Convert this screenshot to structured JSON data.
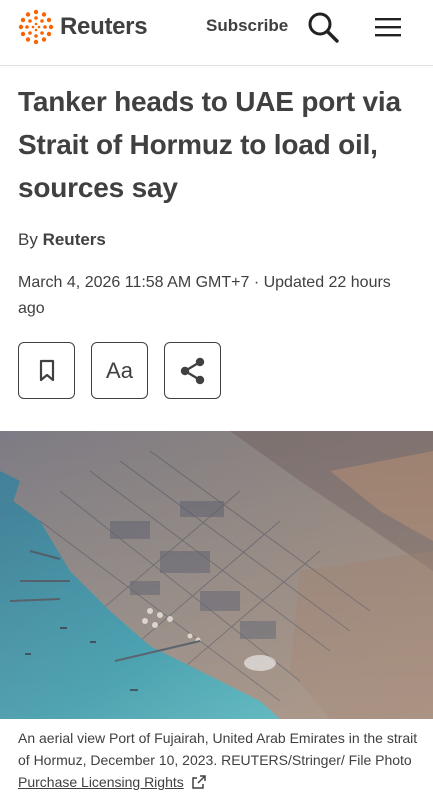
{
  "header": {
    "brand": "Reuters",
    "subscribe_label": "Subscribe",
    "search_icon": "search-icon",
    "menu_icon": "hamburger-menu-icon",
    "brand_color": "#fa6400"
  },
  "article": {
    "headline": "Tanker heads to UAE port via Strait of Hormuz to load oil, sources say",
    "byline_prefix": "By",
    "author": "Reuters",
    "dateline": "March 4, 2026 11:58 AM GMT+7 · Updated 22 hours ago"
  },
  "tools": {
    "bookmark_icon": "bookmark-icon",
    "text_size_label": "Aa",
    "share_icon": "share-icon"
  },
  "photo": {
    "caption": "An aerial view Port of Fujairah, United Arab Emirates in the strait of Hormuz, December 10, 2023. REUTERS/Stringer/ File Photo",
    "licensing_link": "Purchase Licensing Rights",
    "external_icon": "external-link-icon"
  }
}
